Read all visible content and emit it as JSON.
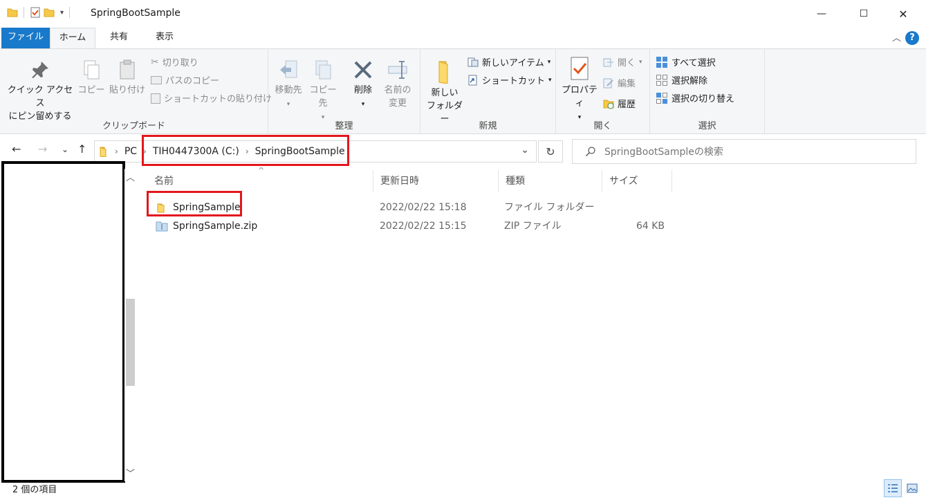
{
  "window": {
    "title": "SpringBootSample",
    "minimize": "—",
    "maximize": "☐",
    "close": "✕"
  },
  "ribbon_tabs": [
    "ファイル",
    "ホーム",
    "共有",
    "表示"
  ],
  "ribbon": {
    "clipboard": {
      "label": "クリップボード",
      "pin_line1": "クイック アクセス",
      "pin_line2": "にピン留めする",
      "copy": "コピー",
      "paste": "貼り付け",
      "cut": "切り取り",
      "copy_path": "パスのコピー",
      "paste_shortcut": "ショートカットの貼り付け"
    },
    "organize": {
      "label": "整理",
      "move_to": "移動先",
      "copy_to": "コピー先",
      "delete": "削除",
      "rename_line1": "名前の",
      "rename_line2": "変更"
    },
    "new": {
      "label": "新規",
      "new_folder_line1": "新しい",
      "new_folder_line2": "フォルダー",
      "new_item": "新しいアイテム",
      "shortcut": "ショートカット"
    },
    "open": {
      "label": "開く",
      "properties": "プロパティ",
      "open": "開く",
      "edit": "編集",
      "history": "履歴"
    },
    "select": {
      "label": "選択",
      "select_all": "すべて選択",
      "select_none": "選択解除",
      "invert": "選択の切り替え"
    }
  },
  "address": {
    "crumbs": [
      "PC",
      "TIH0447300A (C:)",
      "SpringBootSample"
    ]
  },
  "search": {
    "placeholder": "SpringBootSampleの検索"
  },
  "columns": [
    "名前",
    "更新日時",
    "種類",
    "サイズ"
  ],
  "files": [
    {
      "name": "SpringSample",
      "modified": "2022/02/22 15:18",
      "type": "ファイル フォルダー",
      "size": "",
      "icon": "folder-icon"
    },
    {
      "name": "SpringSample.zip",
      "modified": "2022/02/22 15:15",
      "type": "ZIP ファイル",
      "size": "64 KB",
      "icon": "zip-icon"
    }
  ],
  "status": {
    "item_count": "2 個の項目"
  },
  "colors": {
    "accent": "#1979ca",
    "highlight_box": "#e3161c",
    "folder": "#f7c948"
  }
}
